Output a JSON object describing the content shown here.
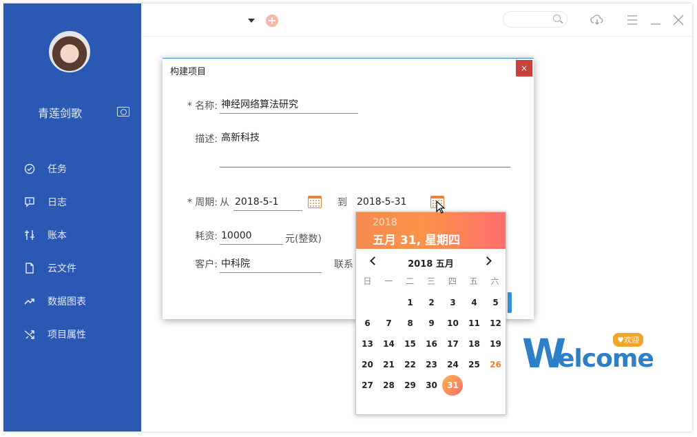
{
  "sidebar": {
    "username": "青莲剑歌",
    "items": [
      {
        "label": "任务",
        "icon": "check-circle-icon"
      },
      {
        "label": "日志",
        "icon": "comment-alert-icon"
      },
      {
        "label": "账本",
        "icon": "ledger-icon"
      },
      {
        "label": "云文件",
        "icon": "file-icon"
      },
      {
        "label": "数据图表",
        "icon": "trend-icon"
      },
      {
        "label": "项目属性",
        "icon": "shuffle-icon"
      }
    ]
  },
  "topbar": {
    "icons": [
      "chevron-down-icon",
      "add-icon",
      "search-icon",
      "cloud-download-icon",
      "menu-icon",
      "minimize-icon",
      "close-icon"
    ]
  },
  "welcome": {
    "first": "W",
    "rest": "elcome",
    "badge": "♥欢迎"
  },
  "dialog": {
    "title": "构建项目",
    "close": "×",
    "name_label": "* 名称:",
    "name_value": "神经网络算法研究",
    "desc_label": "描述:",
    "desc_value": "高新科技",
    "period_label": "* 周期:",
    "from_label": "从",
    "from_value": "2018-5-1",
    "to_label": "到",
    "to_value": "2018-5-31",
    "cost_label": "耗资:",
    "cost_value": "10000",
    "cost_unit": "元(整数)",
    "client_label": "客户:",
    "client_value": "中科院",
    "contact_label": "联系"
  },
  "datepicker": {
    "year": "2018",
    "date_long": "五月 31, 星期四",
    "month_label": "2018 五月",
    "weekdays": [
      "日",
      "一",
      "二",
      "三",
      "四",
      "五",
      "六"
    ],
    "leading_blanks": 2,
    "days": [
      "1",
      "2",
      "3",
      "4",
      "5",
      "6",
      "7",
      "8",
      "9",
      "10",
      "11",
      "12",
      "13",
      "14",
      "15",
      "16",
      "17",
      "18",
      "19",
      "20",
      "21",
      "22",
      "23",
      "24",
      "25",
      "26",
      "27",
      "28",
      "29",
      "30",
      "31"
    ],
    "highlight_day": "26",
    "selected_day": "31"
  }
}
